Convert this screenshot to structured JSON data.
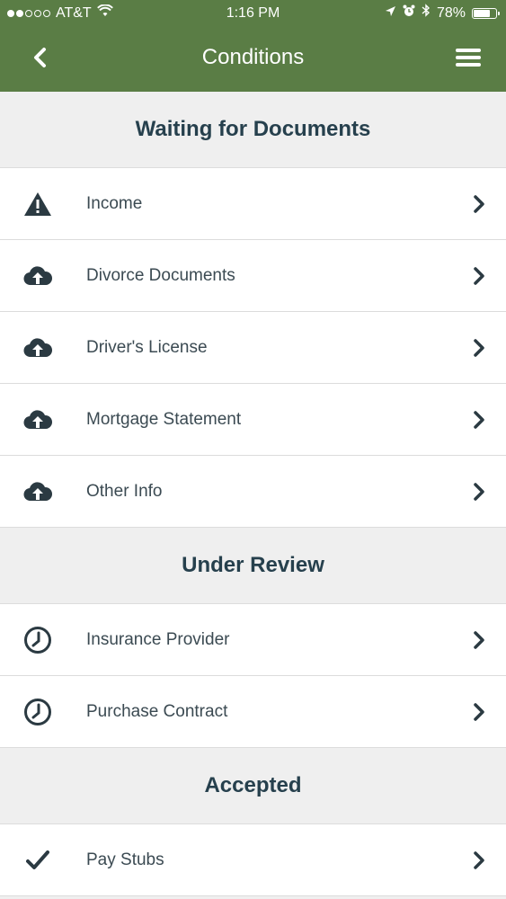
{
  "status_bar": {
    "carrier": "AT&T",
    "time": "1:16 PM",
    "battery_percent": "78%",
    "battery_level": 0.78,
    "signal_bars_filled": 2,
    "signal_bars_total": 5
  },
  "nav": {
    "title": "Conditions"
  },
  "colors": {
    "header": "#5a7d45",
    "section_title": "#26404d",
    "icon": "#2b3a42"
  },
  "sections": [
    {
      "title": "Waiting for Documents",
      "items": [
        {
          "label": "Income",
          "icon": "warning-icon"
        },
        {
          "label": "Divorce Documents",
          "icon": "cloud-upload-icon"
        },
        {
          "label": "Driver's License",
          "icon": "cloud-upload-icon"
        },
        {
          "label": "Mortgage Statement",
          "icon": "cloud-upload-icon"
        },
        {
          "label": "Other Info",
          "icon": "cloud-upload-icon"
        }
      ]
    },
    {
      "title": "Under Review",
      "items": [
        {
          "label": "Insurance Provider",
          "icon": "clock-icon"
        },
        {
          "label": "Purchase Contract",
          "icon": "clock-icon"
        }
      ]
    },
    {
      "title": "Accepted",
      "items": [
        {
          "label": "Pay Stubs",
          "icon": "checkmark-icon"
        }
      ]
    }
  ]
}
